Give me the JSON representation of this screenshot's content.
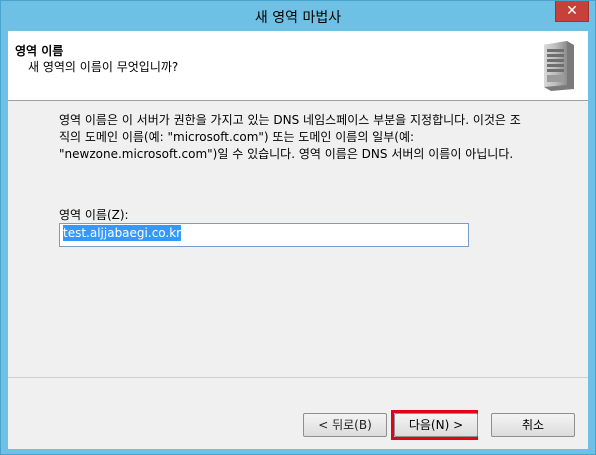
{
  "window": {
    "title": "새 영역 마법사",
    "close_glyph": "✕"
  },
  "header": {
    "title": "영역 이름",
    "subtitle": "새 영역의 이름이 무엇입니까?"
  },
  "body": {
    "description_line1": "영역 이름은 이 서버가 권한을 가지고 있는 DNS 네임스페이스 부분을 지정합니다. 이것은 조",
    "description_line2": "직의 도메인 이름(예: \"microsoft.com\") 또는 도메인 이름의 일부(예:",
    "description_line3": "\"newzone.microsoft.com\")일 수 있습니다. 영역 이름은 DNS 서버의 이름이 아닙니다.",
    "zone_name_label": "영역 이름(Z):",
    "zone_name_value": "test.aljjabaegi.co.kr"
  },
  "buttons": {
    "back": "< 뒤로(B)",
    "next": "다음(N) >",
    "cancel": "취소"
  },
  "colors": {
    "titlebar": "#6ec1e4",
    "highlight": "#e3001b",
    "selection": "#3399ff"
  }
}
